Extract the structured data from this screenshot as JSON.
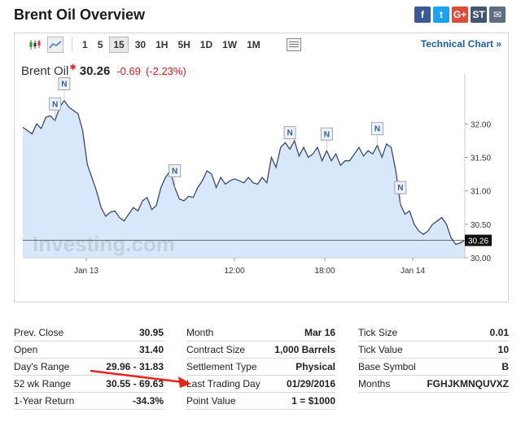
{
  "page": {
    "title": "Brent Oil Overview"
  },
  "social": [
    {
      "name": "facebook-icon",
      "glyph": "f",
      "color": "#3b5998"
    },
    {
      "name": "twitter-icon",
      "glyph": "t",
      "color": "#1da1f2"
    },
    {
      "name": "google-plus-icon",
      "glyph": "G+",
      "color": "#dd4b39"
    },
    {
      "name": "stocktwits-icon",
      "glyph": "ST",
      "color": "#40576f"
    },
    {
      "name": "email-icon",
      "glyph": "✉",
      "color": "#5f6f80"
    }
  ],
  "toolbar": {
    "timeframes": [
      "1",
      "5",
      "15",
      "30",
      "1H",
      "5H",
      "1D",
      "1W",
      "1M"
    ],
    "active_timeframe": "15",
    "tech_link": "Technical Chart »"
  },
  "quote": {
    "name": "Brent Oil",
    "last": "30.26",
    "change": "-0.69",
    "change_pct": "(-2.23%)"
  },
  "chart_data": {
    "type": "area",
    "x_ticks": [
      "Jan 13",
      "12:00",
      "18:00",
      "Jan 14"
    ],
    "y_ticks": [
      "32.00",
      "31.50",
      "31.00",
      "30.50",
      "30.00"
    ],
    "ylim": [
      30.0,
      32.6
    ],
    "last_label": "30.26",
    "watermark": "Investing.com",
    "line_color": "#3b4a6b",
    "fill_color": "#d8e8fa",
    "values": [
      31.95,
      31.9,
      31.85,
      32.0,
      31.93,
      32.1,
      32.12,
      32.05,
      32.25,
      32.35,
      32.25,
      32.2,
      32.15,
      31.9,
      31.4,
      31.2,
      31.0,
      30.75,
      30.62,
      30.68,
      30.7,
      30.6,
      30.55,
      30.65,
      30.75,
      30.7,
      30.85,
      30.9,
      30.72,
      30.78,
      31.05,
      31.2,
      31.3,
      31.05,
      30.88,
      30.85,
      30.92,
      30.9,
      31.05,
      31.15,
      31.3,
      31.25,
      31.05,
      31.2,
      31.1,
      31.15,
      31.18,
      31.15,
      31.12,
      31.2,
      31.12,
      31.1,
      31.2,
      31.12,
      31.5,
      31.35,
      31.65,
      31.72,
      31.62,
      31.75,
      31.52,
      31.65,
      31.5,
      31.55,
      31.65,
      31.45,
      31.6,
      31.45,
      31.55,
      31.38,
      31.45,
      31.45,
      31.55,
      31.65,
      31.52,
      31.6,
      31.55,
      31.68,
      31.5,
      31.7,
      31.65,
      31.3,
      30.8,
      30.65,
      30.7,
      30.5,
      30.4,
      30.35,
      30.4,
      30.5,
      30.55,
      30.6,
      30.5,
      30.3,
      30.2,
      30.22,
      30.26
    ],
    "news_markers": [
      {
        "label": "N",
        "index": 7
      },
      {
        "label": "N",
        "index": 9
      },
      {
        "label": "N",
        "index": 33
      },
      {
        "label": "N",
        "index": 58
      },
      {
        "label": "N",
        "index": 66
      },
      {
        "label": "N",
        "index": 77
      },
      {
        "label": "N",
        "index": 82
      }
    ]
  },
  "stats": {
    "col1": [
      {
        "key": "Prev. Close",
        "value": "30.95"
      },
      {
        "key": "Open",
        "value": "31.40"
      },
      {
        "key": "Day's Range",
        "value": "29.96 - 31.83"
      },
      {
        "key": "52 wk Range",
        "value": "30.55 - 69.63"
      },
      {
        "key": "1-Year Return",
        "value": "-34.3%"
      }
    ],
    "col2": [
      {
        "key": "Month",
        "value": "Mar 16"
      },
      {
        "key": "Contract Size",
        "value": "1,000 Barrels"
      },
      {
        "key": "Settlement Type",
        "value": "Physical"
      },
      {
        "key": "Last Trading Day",
        "value": "01/29/2016"
      },
      {
        "key": "Point Value",
        "value": "1 = $1000"
      }
    ],
    "col3": [
      {
        "key": "Tick Size",
        "value": "0.01"
      },
      {
        "key": "Tick Value",
        "value": "10"
      },
      {
        "key": "Base Symbol",
        "value": "B"
      },
      {
        "key": "Months",
        "value": "FGHJKMNQUVXZ"
      }
    ]
  }
}
